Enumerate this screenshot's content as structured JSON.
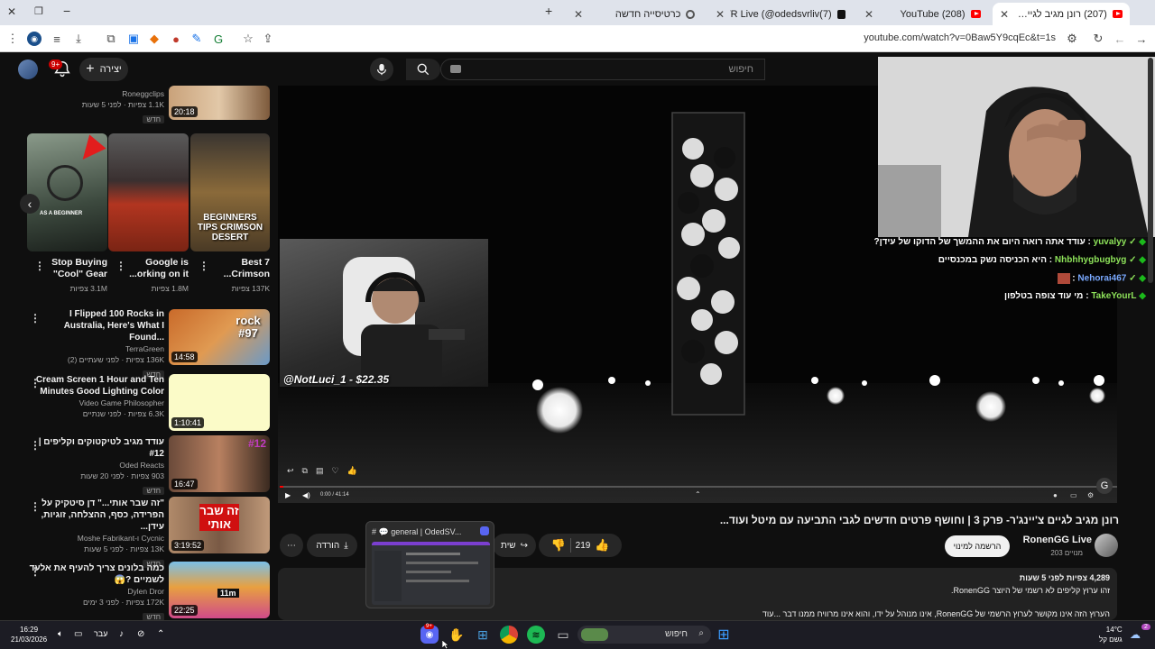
{
  "browser": {
    "tabs": [
      {
        "label": "(207) רונן מגיב לגיים צ'יינג'ר- פרק",
        "active": true
      },
      {
        "label": "(208) YouTube",
        "active": false
      },
      {
        "label": "(7)OdedSVR Live (@odedsvrliv",
        "active": false
      },
      {
        "label": "כרטיסייה חדשה",
        "active": false
      }
    ],
    "url": "youtube.com/watch?v=0Baw5Y9cqEc&t=1s"
  },
  "header": {
    "search_placeholder": "חיפוש",
    "create_label": "יצירה",
    "notif_count": "9+"
  },
  "sidebar": {
    "top_item": {
      "channel": "Roneggclips",
      "meta": "1.1K צפיות · לפני 5 שעות",
      "badge": "חדש",
      "duration": "20:18"
    },
    "shorts": [
      {
        "title": "Stop Buying \"Cool\" Gear",
        "views": "3.1M צפיות",
        "thumb_text": "AS A BEGINNER"
      },
      {
        "title": "Google is ...orking on it",
        "views": "1.8M צפיות",
        "thumb_text": ""
      },
      {
        "title": "Best 7 ...Crimson",
        "views": "137K צפיות",
        "thumb_text": "BEGINNERS TIPS CRIMSON DESERT"
      }
    ],
    "videos": [
      {
        "title": "I Flipped 100 Rocks in Australia, Here's What I Found...",
        "channel": "TerraGreen",
        "meta": "136K צפיות · לפני שעתיים (2)",
        "badge": "חדש",
        "duration": "14:58",
        "thumb_text": "rock #97"
      },
      {
        "title": "Cream Screen 1 Hour and Ten Minutes Good Lighting Color",
        "channel": "Video Game Philosopher",
        "meta": "6.3K צפיות · לפני שנתיים",
        "badge": "",
        "duration": "1:10:41",
        "thumb_text": ""
      },
      {
        "title": "עודד מגיב לטיקטוקים וקליפים | #12",
        "channel": "Oded Reacts",
        "meta": "903 צפיות · לפני 20 שעות",
        "badge": "חדש",
        "duration": "16:47",
        "thumb_text": "#12"
      },
      {
        "title": "\"זה שבר אותי...\" דן סיטקיק על הפרידה, כסף, ההצלחה, זוגיות, עידן...",
        "channel": "Cycnic ו-Moshe Fabrikant",
        "meta": "13K צפיות · לפני 5 שעות",
        "badge": "חדש",
        "duration": "3:19:52",
        "thumb_text": "זה שבר אותי"
      },
      {
        "title": "כמה בלונים צריך להעיף את אלעד לשמיים ?😱",
        "channel": "Dylen Dror",
        "meta": "172K צפיות · לפני 3 ימים",
        "badge": "חדש",
        "duration": "22:25",
        "thumb_text": "11m"
      }
    ]
  },
  "player": {
    "donation": "@NotLuci_1 - $22.35",
    "time": "0:00 / 41:14"
  },
  "chat": [
    {
      "user": "yuvalyy",
      "msg": ": עודד אתה רואה היום את ההמשך של הדוקו של עידן?",
      "color": "#8ee35a"
    },
    {
      "user": "Nhbhhygbugbyg",
      "msg": ": היא הכניסה נשק במכנסיים",
      "color": "#8ee35a"
    },
    {
      "user": "Nehorai467",
      "msg": ":",
      "color": "#7aa9ff"
    },
    {
      "user": "TakeYourL",
      "msg": ": מי עוד צופה בטלפון",
      "color": "#8ee35a"
    }
  ],
  "video": {
    "title": "רונן מגיב לגיים צ'יינג'ר- פרק 3 | וחושף פרטים חדשים לגבי התביעה עם מיטל ועוד...",
    "channel": "RonenGG Live",
    "subscribers": "203 מנויים",
    "subscribe_label": "הרשמה למינוי",
    "likes": "219",
    "share_label": "שית",
    "download_label": "הורדה",
    "description_meta": "4,289 צפיות  לפני 5 שעות",
    "description_line1": "זהו ערוץ קליפים לא רשמי של היוצר RonenGG.",
    "description_line2": "הערוץ הזה אינו מקושר לערוץ הרשמי של RonenGG, אינו מנוהל על ידו, והוא אינו מרוויח ממנו דבר ...עוד"
  },
  "preview_popup": {
    "title": "general | OdedSV..."
  },
  "taskbar": {
    "time": "16:29",
    "date": "21/03/2026",
    "lang": "עבר",
    "search_label": "חיפוש",
    "weather_temp": "14°C",
    "weather_desc": "גשם קל",
    "notif_count": "2"
  }
}
